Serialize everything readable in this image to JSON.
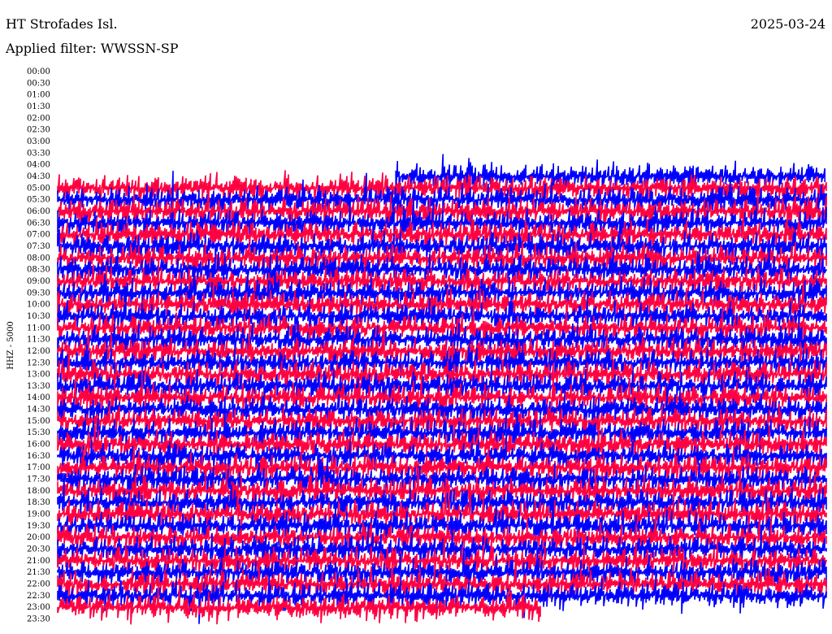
{
  "header": {
    "station": "HT Strofades Isl.",
    "date": "2025-03-24",
    "filter_prefix": "Applied filter:",
    "filter_name": "WWSSN-SP"
  },
  "chart_data": {
    "type": "line",
    "title": "HT Strofades Isl.",
    "date": "2025-03-24",
    "filter": "WWSSN-SP",
    "ylabel": "HHZ - 5000",
    "xlabel": "",
    "row_labels": [
      "00:00",
      "00:30",
      "01:00",
      "01:30",
      "02:00",
      "02:30",
      "03:00",
      "03:30",
      "04:00",
      "04:30",
      "05:00",
      "05:30",
      "06:00",
      "06:30",
      "07:00",
      "07:30",
      "08:00",
      "08:30",
      "09:00",
      "09:30",
      "10:00",
      "10:30",
      "11:00",
      "11:30",
      "12:00",
      "12:30",
      "13:00",
      "13:30",
      "14:00",
      "14:30",
      "15:00",
      "15:30",
      "16:00",
      "16:30",
      "17:00",
      "17:30",
      "18:00",
      "18:30",
      "19:00",
      "19:30",
      "20:00",
      "20:30",
      "21:00",
      "21:30",
      "22:00",
      "22:30",
      "23:00",
      "23:30"
    ],
    "row_minutes": 30,
    "series_colors": [
      "#ff0040",
      "#0000ff"
    ],
    "data_start_row": 9,
    "data_start_fraction": 0.44,
    "data_end_row": 46,
    "data_end_fraction": 0.63,
    "event": {
      "time": "17:40",
      "note": ""
    }
  }
}
